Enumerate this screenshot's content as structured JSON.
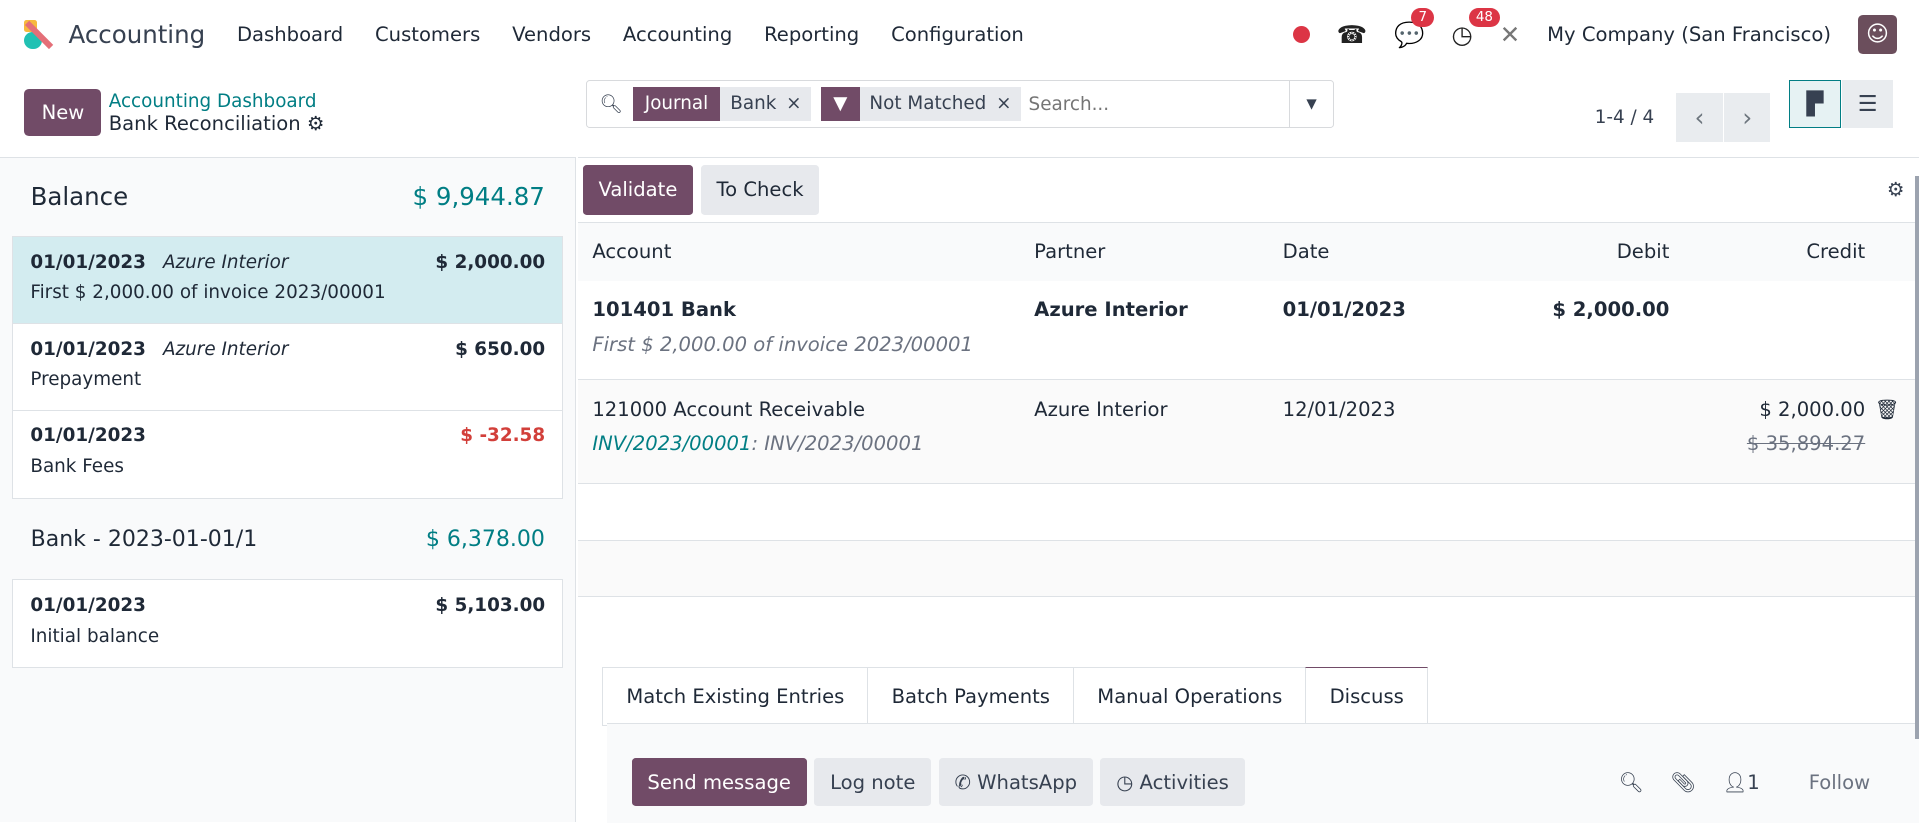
{
  "app": {
    "name": "Accounting",
    "menu": [
      "Dashboard",
      "Customers",
      "Vendors",
      "Accounting",
      "Reporting",
      "Configuration"
    ],
    "company": "My Company (San Francisco)",
    "badges": {
      "messages": "7",
      "activities": "48"
    }
  },
  "control": {
    "new": "New",
    "breadcrumb_parent": "Accounting Dashboard",
    "breadcrumb_current": "Bank Reconciliation",
    "facets": [
      {
        "key": "Journal",
        "value": "Bank"
      },
      {
        "value": "Not Matched"
      }
    ],
    "search_placeholder": "Search...",
    "pager": "1-4 / 4"
  },
  "left": {
    "balance_label": "Balance",
    "balance": "$ 9,944.87",
    "lines": [
      {
        "date": "01/01/2023",
        "partner": "Azure Interior",
        "amount": "$ 2,000.00",
        "label": "First $ 2,000.00 of invoice 2023/00001"
      },
      {
        "date": "01/01/2023",
        "partner": "Azure Interior",
        "amount": "$ 650.00",
        "label": "Prepayment"
      },
      {
        "date": "01/01/2023",
        "partner": "",
        "amount": "$ -32.58",
        "label": "Bank Fees"
      }
    ],
    "statement": "Bank - 2023-01-01/1",
    "statement_amount": "$ 6,378.00",
    "statement_lines": [
      {
        "date": "01/01/2023",
        "amount": "$ 5,103.00",
        "label": "Initial balance"
      }
    ]
  },
  "main": {
    "validate": "Validate",
    "to_check": "To Check",
    "headers": [
      "Account",
      "Partner",
      "Date",
      "Debit",
      "Credit"
    ],
    "rows": [
      {
        "account": "101401 Bank",
        "partner": "Azure Interior",
        "date": "01/01/2023",
        "debit": "$ 2,000.00",
        "sub": "First $ 2,000.00 of invoice 2023/00001"
      },
      {
        "account": "121000 Account Receivable",
        "partner": "Azure Interior",
        "date": "12/01/2023",
        "credit": "$ 2,000.00",
        "credit_old": "$ 35,894.27",
        "link": "INV/2023/00001",
        "sub": ": INV/2023/00001"
      }
    ],
    "tabs": [
      "Match Existing Entries",
      "Batch Payments",
      "Manual Operations",
      "Discuss"
    ],
    "chatter": {
      "send": "Send message",
      "log": "Log note",
      "whatsapp": "WhatsApp",
      "activities": "Activities",
      "followers": "1",
      "follow": "Follow"
    }
  }
}
